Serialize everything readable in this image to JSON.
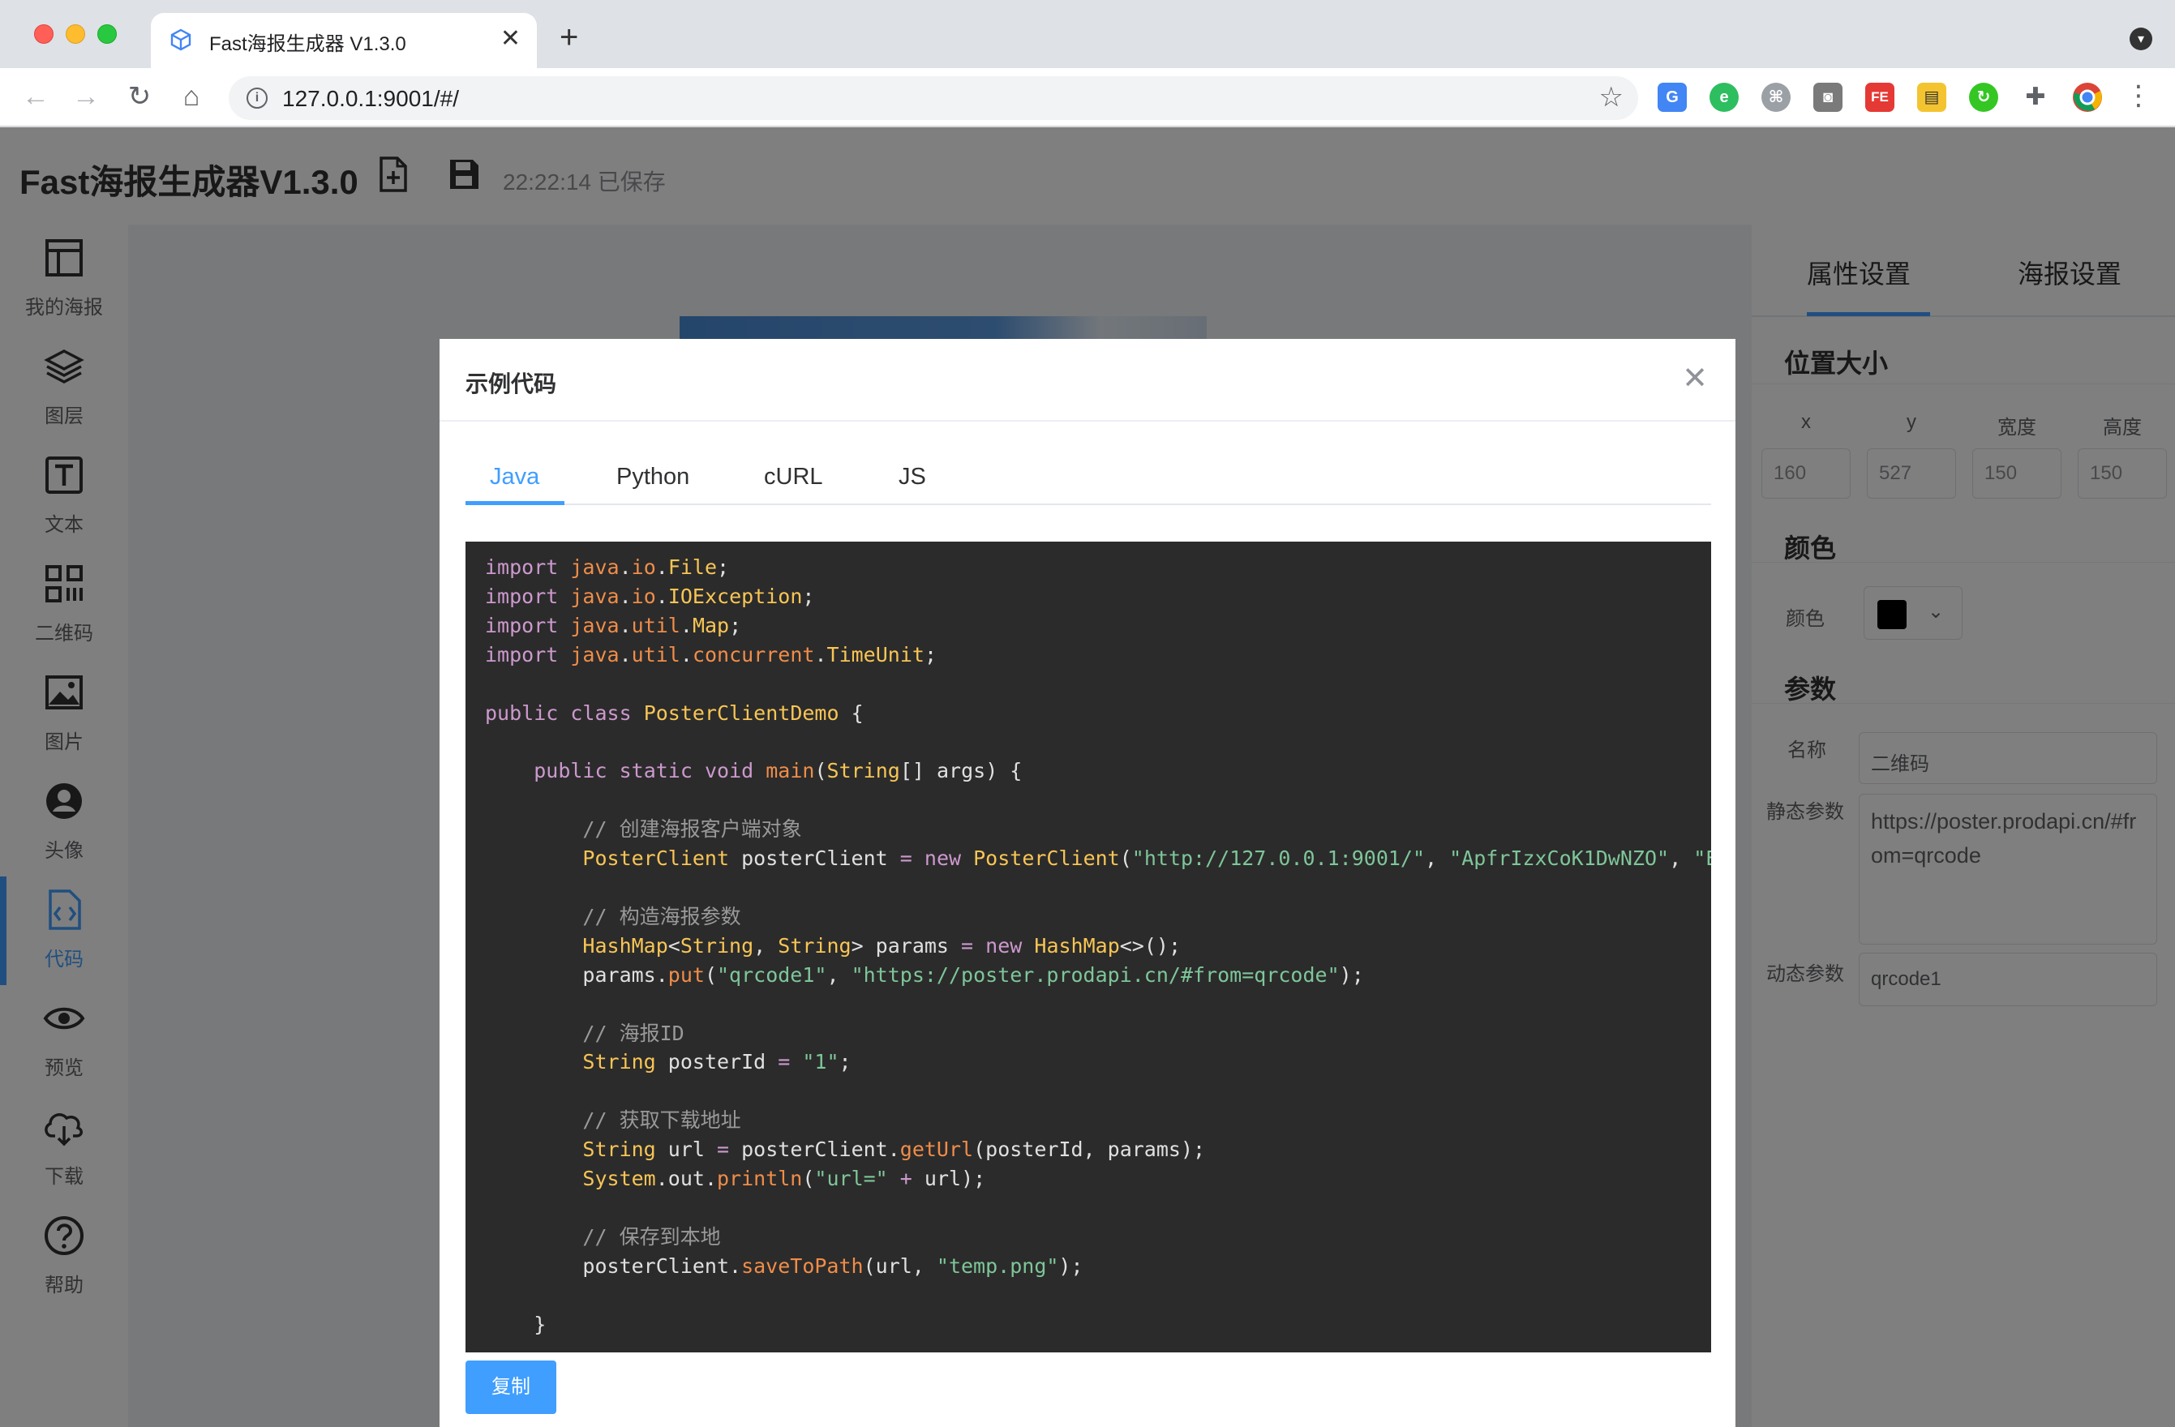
{
  "browser": {
    "tab_title": "Fast海报生成器 V1.3.0",
    "tab_close": "✕",
    "new_tab": "+",
    "url": "127.0.0.1:9001/#/",
    "extension_fe_label": "FE"
  },
  "app": {
    "title": "Fast海报生成器V1.3.0",
    "save_status": "22:22:14 已保存"
  },
  "sidebar": {
    "items": [
      {
        "label": "我的海报",
        "icon": "layout-icon"
      },
      {
        "label": "图层",
        "icon": "layers-icon"
      },
      {
        "label": "文本",
        "icon": "text-icon"
      },
      {
        "label": "二维码",
        "icon": "qrcode-icon"
      },
      {
        "label": "图片",
        "icon": "image-icon"
      },
      {
        "label": "头像",
        "icon": "avatar-icon"
      },
      {
        "label": "代码",
        "icon": "code-file-icon",
        "active": true
      },
      {
        "label": "预览",
        "icon": "eye-icon"
      },
      {
        "label": "下载",
        "icon": "cloud-download-icon"
      },
      {
        "label": "帮助",
        "icon": "help-icon"
      }
    ]
  },
  "right_panel": {
    "tabs": [
      "属性设置",
      "海报设置"
    ],
    "position_section": "位置大小",
    "pos_labels": [
      "x",
      "y",
      "宽度",
      "高度"
    ],
    "pos_values": [
      "160",
      "527",
      "150",
      "150"
    ],
    "color_section": "颜色",
    "color_label": "颜色",
    "params_section": "参数",
    "name_label": "名称",
    "name_value": "二维码",
    "static_label": "静态参数",
    "static_value": "https://poster.prodapi.cn/#from=qrcode",
    "dynamic_label": "动态参数",
    "dynamic_value": "qrcode1"
  },
  "dialog": {
    "title": "示例代码",
    "close": "✕",
    "tabs": [
      "Java",
      "Python",
      "cURL",
      "JS"
    ],
    "active_tab": "Java",
    "copy_label": "复制"
  },
  "colors": {
    "accent": "#409eff",
    "code_bg": "#2b2b2b",
    "overlay": "rgba(0,0,0,0.5)"
  }
}
